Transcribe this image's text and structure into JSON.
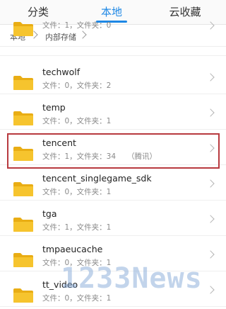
{
  "tabs": [
    {
      "label": "分类"
    },
    {
      "label": "本地"
    },
    {
      "label": "云收藏"
    }
  ],
  "breadcrumb": {
    "items": [
      "本地",
      "内部存储"
    ]
  },
  "files": [
    {
      "name": "",
      "meta": "文件：1，文件夹：0"
    },
    {
      "name": "techwolf",
      "meta": "文件：0，文件夹：2"
    },
    {
      "name": "temp",
      "meta": "文件：0，文件夹：1"
    },
    {
      "name": "tencent",
      "meta": "文件：1，文件夹：34",
      "note": "（腾讯）",
      "highlighted": true
    },
    {
      "name": "tencent_singlegame_sdk",
      "meta": "文件：0，文件夹：1"
    },
    {
      "name": "tga",
      "meta": "文件：1，文件夹：1"
    },
    {
      "name": "tmpaeucache",
      "meta": "文件：0，文件夹：1"
    },
    {
      "name": "tt_video",
      "meta": "文件：0，文件夹：1"
    }
  ],
  "watermark": "1233News",
  "colors": {
    "accent": "#1e88e5",
    "folder": "#f6c42e",
    "highlight": "#b83a3f"
  }
}
